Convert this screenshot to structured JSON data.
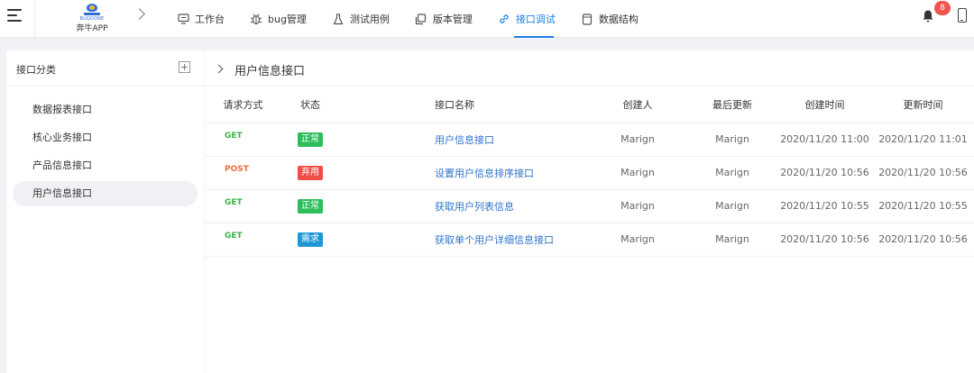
{
  "brand": {
    "logo_text": "BUGDONE",
    "name": "奔牛APP"
  },
  "nav": [
    {
      "label": "工作台",
      "icon": "monitor-icon"
    },
    {
      "label": "bug管理",
      "icon": "bug-icon"
    },
    {
      "label": "测试用例",
      "icon": "flask-icon"
    },
    {
      "label": "版本管理",
      "icon": "copy-icon"
    },
    {
      "label": "接口调试",
      "icon": "link-icon",
      "active": true
    },
    {
      "label": "数据结构",
      "icon": "database-icon"
    }
  ],
  "header": {
    "notification_count": "8"
  },
  "sidebar": {
    "title": "接口分类",
    "items": [
      {
        "label": "数据报表接口"
      },
      {
        "label": "核心业务接口"
      },
      {
        "label": "产品信息接口"
      },
      {
        "label": "用户信息接口",
        "active": true
      }
    ]
  },
  "content": {
    "title": "用户信息接口",
    "columns": [
      "请求方式",
      "状态",
      "接口名称",
      "创建人",
      "最后更新",
      "创建时间",
      "更新时间"
    ],
    "rows": [
      {
        "method": "GET",
        "status": "正常",
        "status_type": "ok",
        "name": "用户信息接口",
        "creator": "Marign",
        "updater": "Marign",
        "created": "2020/11/20 11:00",
        "updated": "2020/11/20 11:01"
      },
      {
        "method": "POST",
        "status": "弃用",
        "status_type": "dis",
        "name": "设置用户信息排序接口",
        "creator": "Marign",
        "updater": "Marign",
        "created": "2020/11/20 10:56",
        "updated": "2020/11/20 10:56"
      },
      {
        "method": "GET",
        "status": "正常",
        "status_type": "ok",
        "name": "获取用户列表信息",
        "creator": "Marign",
        "updater": "Marign",
        "created": "2020/11/20 10:55",
        "updated": "2020/11/20 10:55"
      },
      {
        "method": "GET",
        "status": "需求",
        "status_type": "req",
        "name": "获取单个用户详细信息接口",
        "creator": "Marign",
        "updater": "Marign",
        "created": "2020/11/20 10:56",
        "updated": "2020/11/20 10:56"
      }
    ]
  },
  "colors": {
    "accent": "#1f7fe0",
    "status_ok": "#2dbd5a",
    "status_disabled": "#ef4e48",
    "status_requirement": "#1d97d6",
    "method_get": "#3db04a",
    "method_post": "#f06a33"
  }
}
